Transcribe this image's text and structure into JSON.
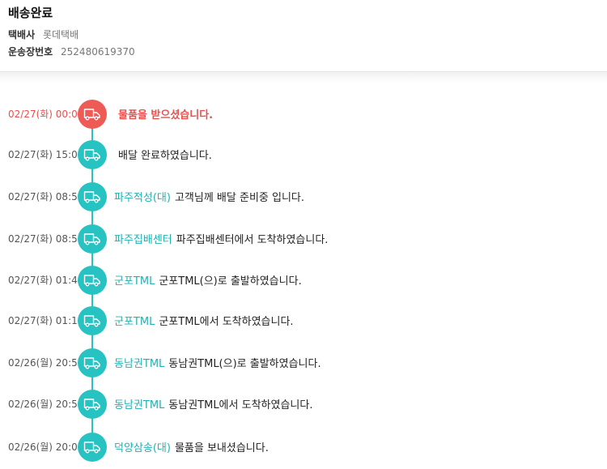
{
  "header": {
    "status": "배송완료",
    "courier_label": "택배사",
    "courier_value": "롯데택배",
    "tracking_label": "운송장번호",
    "tracking_value": "252480619370"
  },
  "colors": {
    "latest": "#ee5a55",
    "normal": "#27c2c2",
    "location_text": "#23b0b0"
  },
  "events": [
    {
      "time": "02/27(화) 00:00",
      "location": "",
      "message": "물품을 받으셨습니다.",
      "icon": "truck-icon"
    },
    {
      "time": "02/27(화) 15:02",
      "location": "",
      "message": "배달 완료하였습니다.",
      "icon": "truck-icon"
    },
    {
      "time": "02/27(화) 08:59",
      "location": "파주적성(대)",
      "message": "고객님께 배달 준비중 입니다.",
      "icon": "truck-icon"
    },
    {
      "time": "02/27(화) 08:57",
      "location": "파주집배센터",
      "message": "파주집배센터에서 도착하였습니다.",
      "icon": "truck-icon"
    },
    {
      "time": "02/27(화) 01:44",
      "location": "군포TML",
      "message": "군포TML(으)로 출발하였습니다.",
      "icon": "truck-icon"
    },
    {
      "time": "02/27(화) 01:10",
      "location": "군포TML",
      "message": "군포TML에서 도착하였습니다.",
      "icon": "truck-icon"
    },
    {
      "time": "02/26(월) 20:57",
      "location": "동남권TML",
      "message": "동남권TML(으)로 출발하였습니다.",
      "icon": "truck-icon"
    },
    {
      "time": "02/26(월) 20:54",
      "location": "동남권TML",
      "message": "동남권TML에서 도착하였습니다.",
      "icon": "truck-icon"
    },
    {
      "time": "02/26(월) 20:00",
      "location": "덕양삼송(대)",
      "message": "물품을 보내셨습니다.",
      "icon": "truck-icon"
    }
  ]
}
